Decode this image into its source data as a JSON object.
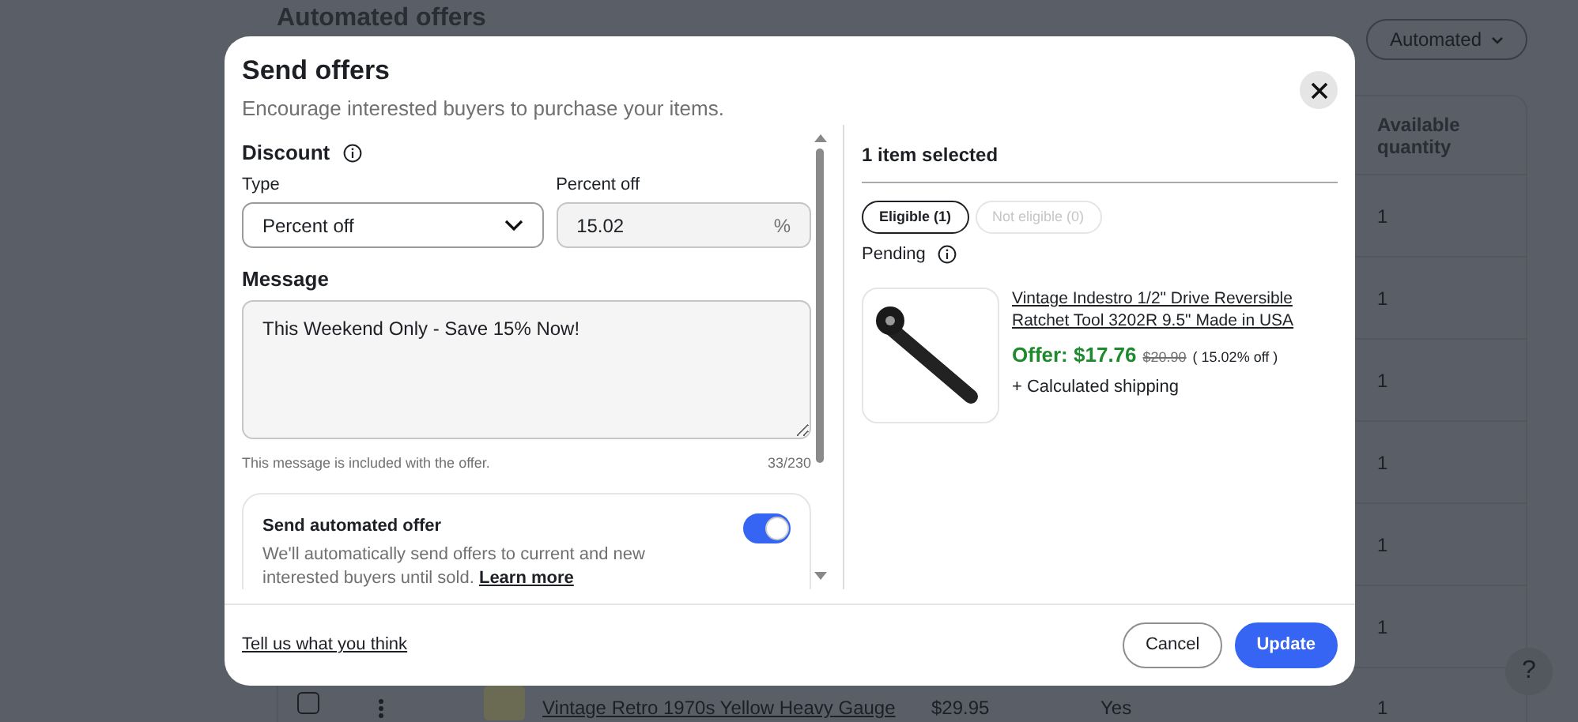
{
  "background": {
    "heading": "Automated offers",
    "filter_button": "Automated",
    "table": {
      "column_header": "Available quantity",
      "quantity_cells": [
        "1",
        "1",
        "1",
        "1",
        "1",
        "1"
      ],
      "last_row": {
        "checked": false,
        "title": "Vintage Retro 1970s Yellow Heavy Gauge",
        "price": "$29.95",
        "status": "Yes",
        "quantity": "1"
      }
    },
    "help_button": "?"
  },
  "modal": {
    "title": "Send offers",
    "subtitle": "Encourage interested buyers to purchase your items.",
    "discount": {
      "label": "Discount",
      "type_label": "Type",
      "type_value": "Percent off",
      "percent_label": "Percent off",
      "percent_value": "15.02",
      "percent_suffix": "%"
    },
    "message": {
      "label": "Message",
      "value": "This Weekend Only - Save 15% Now!",
      "hint": "This message is included with the offer.",
      "count": "33/230"
    },
    "automated_offer": {
      "title": "Send automated offer",
      "description": "We'll automatically send offers to current and new interested buyers until sold.",
      "link": "Learn more",
      "on": true
    },
    "selection": {
      "heading": "1 item selected",
      "filters": [
        {
          "label": "Eligible (1)",
          "selected": true,
          "disabled": false
        },
        {
          "label": "Not eligible (0)",
          "selected": false,
          "disabled": true
        }
      ],
      "pending_label": "Pending",
      "item": {
        "title": "Vintage Indestro 1/2\" Drive Reversible Ratchet Tool 3202R 9.5\" Made in USA",
        "offer": "Offer: $17.76",
        "original_price": "$20.90",
        "discount": "( 15.02% off )",
        "shipping": "+ Calculated shipping"
      }
    },
    "footer": {
      "feedback_link": "Tell us what you think",
      "buttons": [
        {
          "label": "Cancel",
          "kind": "secondary"
        },
        {
          "label": "Update",
          "kind": "primary"
        }
      ]
    }
  }
}
